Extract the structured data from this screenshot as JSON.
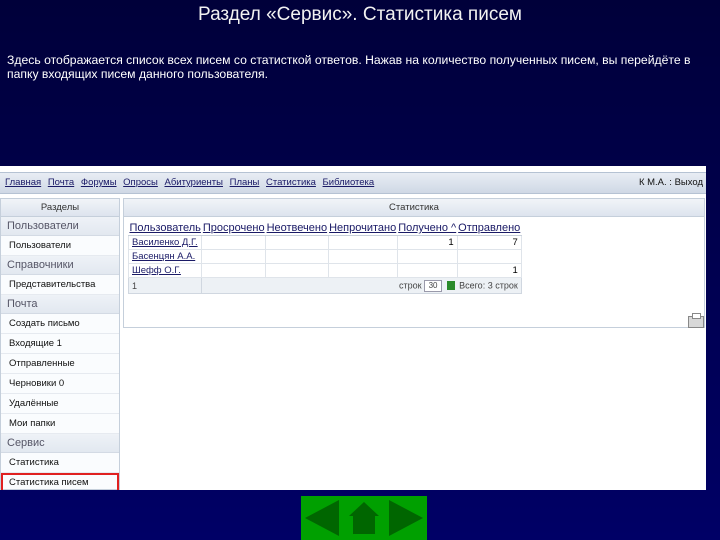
{
  "slide": {
    "title": "Раздел «Сервис». Статистика писем",
    "description": "Здесь отображается список всех писем со статисткой ответов. Нажав на количество полученных писем, вы перейдёте в папку входящих писем данного пользователя."
  },
  "topnav": {
    "items": [
      "Главная",
      "Почта",
      "Форумы",
      "Опросы",
      "Абитуриенты",
      "Планы",
      "Статистика",
      "Библиотека"
    ],
    "user": "К М.А.",
    "exit": "Выход"
  },
  "sidebar": {
    "title": "Разделы",
    "groups": [
      {
        "label": "Пользователи",
        "items": [
          "Пользователи"
        ]
      },
      {
        "label": "Справочники",
        "items": [
          "Представительства"
        ]
      },
      {
        "label": "Почта",
        "items": [
          "Создать письмо",
          "Входящие 1",
          "Отправленные",
          "Черновики 0",
          "Удалённые",
          "Мои папки"
        ]
      },
      {
        "label": "Сервис",
        "items": [
          "Статистика",
          "Статистика писем"
        ]
      }
    ],
    "selected": "Статистика писем"
  },
  "main": {
    "title": "Статистика",
    "columns": [
      "Пользователь",
      "Просрочено",
      "Неотвечено",
      "Непрочитано",
      "Получено ^",
      "Отправлено"
    ],
    "rows": [
      [
        "Василенко Д.Г.",
        "",
        "",
        "",
        "1",
        "7"
      ],
      [
        "Басенцян А.А.",
        "",
        "",
        "",
        "",
        ""
      ],
      [
        "Шефф О.Г.",
        "",
        "",
        "",
        "",
        "1"
      ]
    ],
    "pager": {
      "page": "1",
      "rows_label": "строк",
      "rows_value": "30",
      "total": "Всего: 3 строк"
    }
  },
  "colors": {
    "slide_bg": "#000066",
    "selection_outline": "#e02020",
    "nav_bar_green": "#00a000"
  }
}
